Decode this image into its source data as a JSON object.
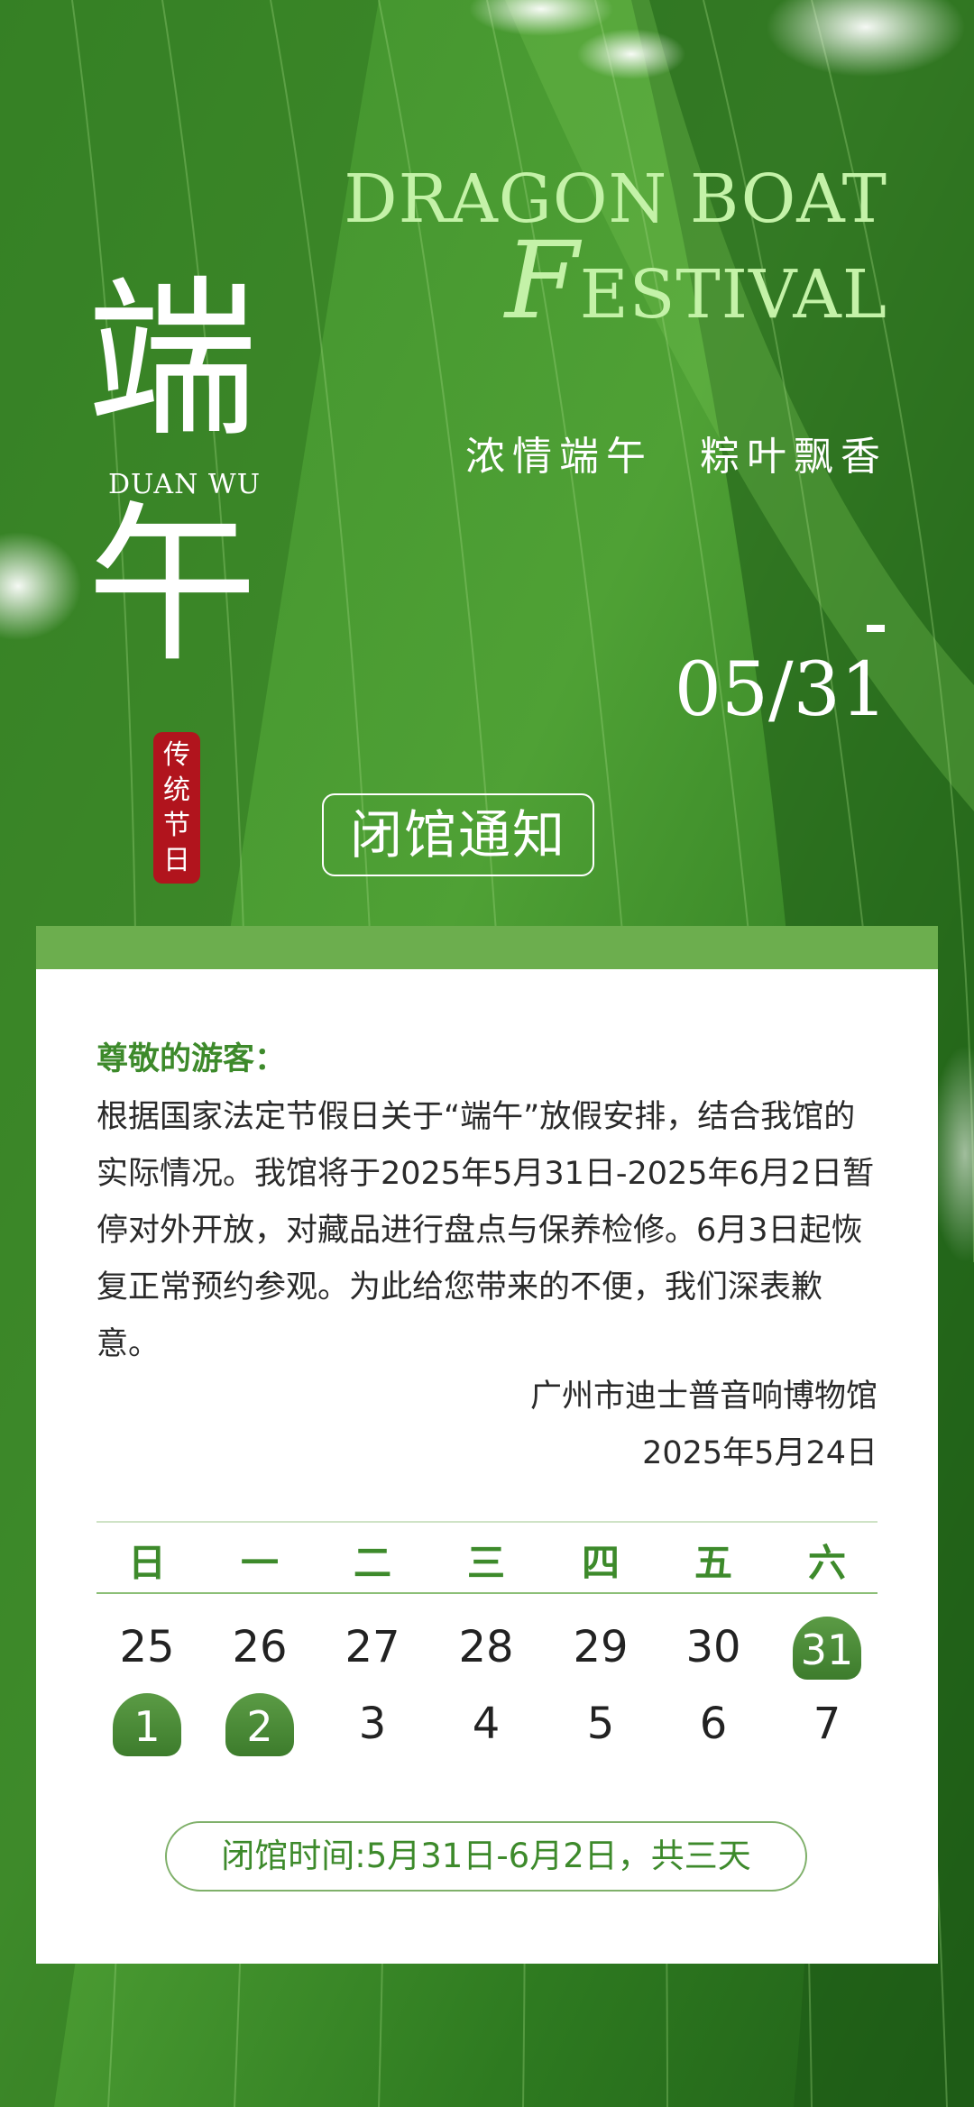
{
  "poster": {
    "title_en_line1": "DRAGON BOAT",
    "title_en_f": "F",
    "title_en_line2_rest": "ESTIVAL",
    "slogan": "浓情端午　粽叶飘香",
    "char1": "端",
    "char2": "午",
    "pinyin": "DUAN WU",
    "seal_text": "传统节日",
    "date": "05/31",
    "notice_button": "闭馆通知"
  },
  "notice": {
    "greeting": "尊敬的游客：",
    "body": "根据国家法定节假日关于“端午”放假安排，结合我馆的实际情况。我馆将于2025年5月31日-2025年6月2日暂停对外开放，对藏品进行盘点与保养检修。6月3日起恢复正常预约参观。为此给您带来的不便，我们深表歉意。",
    "signature_org": "广州市迪士普音响博物馆",
    "signature_date": "2025年5月24日"
  },
  "calendar": {
    "weekdays": [
      "日",
      "一",
      "二",
      "三",
      "四",
      "五",
      "六"
    ],
    "row1": [
      "25",
      "26",
      "27",
      "28",
      "29",
      "30",
      "31"
    ],
    "row2": [
      "1",
      "2",
      "3",
      "4",
      "5",
      "6",
      "7"
    ],
    "highlighted": [
      "31",
      "1",
      "2"
    ]
  },
  "closing_time": "闭馆时间:5月31日-6月2日，共三天",
  "colors": {
    "leaf_green": "#2f7d22",
    "accent_green": "#3d8a2b",
    "title_light_green": "#c4f2a8",
    "seal_red": "#b1141d"
  }
}
